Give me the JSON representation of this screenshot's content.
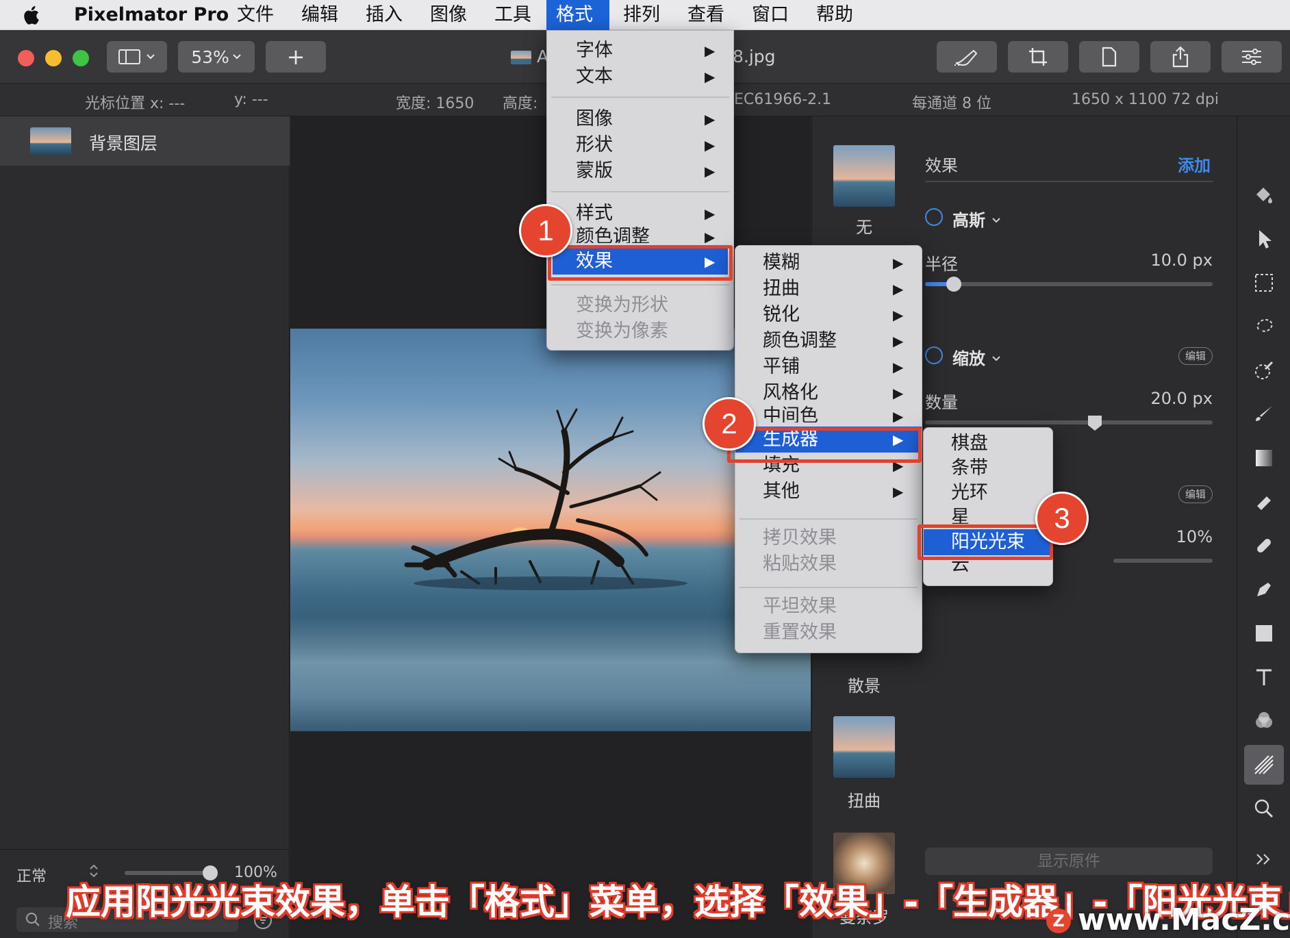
{
  "menubar": {
    "app_name": "Pixelmator Pro",
    "items": [
      "文件",
      "编辑",
      "插入",
      "图像",
      "工具",
      "格式",
      "排列",
      "查看",
      "窗口",
      "帮助"
    ],
    "active": "格式"
  },
  "toolbar": {
    "zoom": "53%",
    "add_label": "+",
    "doc_title_left": "A",
    "doc_title": "8.jpg"
  },
  "infobar": {
    "cursor_x": "光标位置 x:  ---",
    "cursor_y": "y:  ---",
    "width": "宽度:  1650",
    "height": "高度:",
    "profile": "EC61966-2.1",
    "depth": "每通道 8 位",
    "dims": "1650 x 1100 72 dpi"
  },
  "layers": {
    "items": [
      {
        "name": "背景图层"
      }
    ],
    "blend_mode": "正常",
    "opacity": "100%",
    "search_placeholder": "搜索"
  },
  "effects_panel": {
    "title": "效果",
    "add": "添加",
    "presets": [
      "无",
      "散景",
      "扭曲",
      "曼荼罗"
    ],
    "gaussian": {
      "name": "高斯",
      "param": "半径",
      "value": "10.0 px",
      "level": 0.1
    },
    "zoom": {
      "name": "缩放",
      "param": "数量",
      "value": "20.0 px",
      "level": 0.59,
      "edit": "编辑"
    },
    "third": {
      "edit": "编辑",
      "value": "10%"
    },
    "show_original": "显示原件"
  },
  "format_menu": {
    "groups": [
      [
        "字体",
        "文本"
      ],
      [
        "图像",
        "形状",
        "蒙版"
      ],
      [
        "样式",
        "颜色调整",
        "效果"
      ],
      [
        "变换为形状",
        "变换为像素"
      ]
    ],
    "highlighted": "效果"
  },
  "effects_menu": {
    "groups": [
      [
        "模糊",
        "扭曲",
        "锐化",
        "颜色调整",
        "平铺",
        "风格化",
        "中间色",
        "生成器",
        "填充",
        "其他"
      ],
      [
        "拷贝效果",
        "粘贴效果"
      ],
      [
        "平坦效果",
        "重置效果"
      ]
    ],
    "highlighted": "生成器"
  },
  "generator_menu": {
    "items": [
      "棋盘",
      "条带",
      "光环",
      "星",
      "阳光光束",
      "云"
    ],
    "highlighted": "阳光光束"
  },
  "callouts": [
    "1",
    "2",
    "3"
  ],
  "caption": "应用阳光光束效果，单击「格式」菜单，选择「效果」-「生成器」-「阳光光束」",
  "watermark": "www.MacZ.com",
  "watermark_logo": "Z",
  "colors": {
    "accent": "#1e5fd6",
    "callout_red": "#e2412e",
    "link_blue": "#3f89e8"
  }
}
